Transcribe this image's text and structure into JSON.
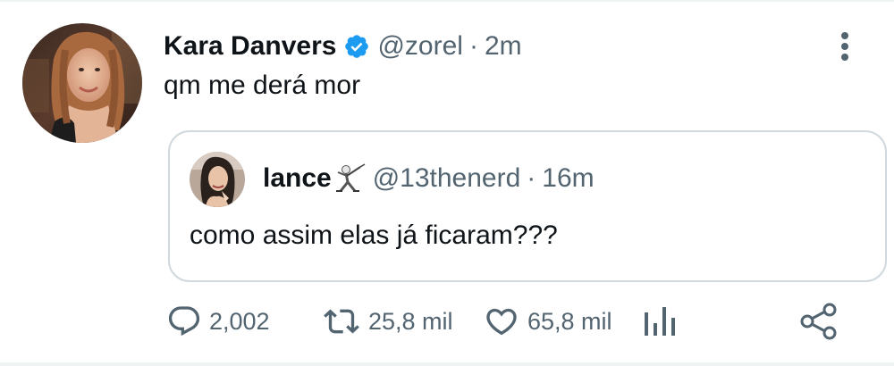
{
  "tweet": {
    "author": {
      "display_name": "Kara Danvers",
      "handle": "@zorel",
      "verified": true,
      "avatar": "profile-photo-woman"
    },
    "separator": "·",
    "time": "2m",
    "text": "qm me derá mor",
    "quoted": {
      "author": {
        "display_name": "lance",
        "name_emoji": "fencer-emoji",
        "handle": "@13thenerd",
        "avatar": "profile-photo-woman"
      },
      "separator": "·",
      "time": "16m",
      "text": "como assim elas já ficaram???"
    },
    "actions": {
      "replies": "2,002",
      "retweets": "25,8 mil",
      "likes": "65,8 mil"
    }
  },
  "icons": {
    "more": "more-vertical-icon",
    "reply": "reply-icon",
    "retweet": "retweet-icon",
    "like": "heart-icon",
    "analytics": "analytics-icon",
    "share": "share-icon"
  },
  "colors": {
    "verified_blue": "#1d9bf0",
    "text_primary": "#0f1419",
    "text_secondary": "#536471",
    "border": "#cfd9de"
  }
}
